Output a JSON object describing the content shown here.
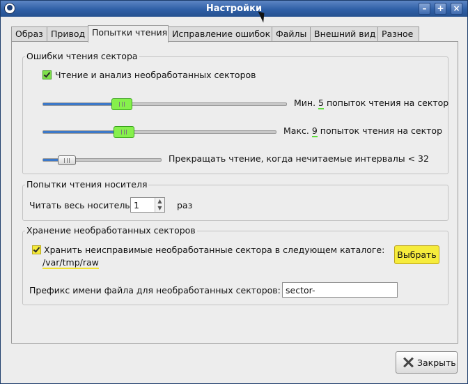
{
  "window": {
    "title": "Настройки"
  },
  "tabs": [
    {
      "label": "Образ",
      "active": false
    },
    {
      "label": "Привод",
      "active": false
    },
    {
      "label": "Попытки чтения",
      "active": true
    },
    {
      "label": "Исправление ошибок",
      "active": false
    },
    {
      "label": "Файлы",
      "active": false
    },
    {
      "label": "Внешний вид",
      "active": false
    },
    {
      "label": "Разное",
      "active": false
    }
  ],
  "sector_errors": {
    "legend": "Ошибки чтения сектора",
    "raw_checkbox_label": "Чтение и анализ необработанных секторов",
    "raw_checked": true,
    "min_retries": {
      "prefix": "Мин.",
      "value": "5",
      "suffix": "попыток чтения на сектор",
      "fraction": 0.32
    },
    "max_retries": {
      "prefix": "Макс.",
      "value": "9",
      "suffix": "попыток чтения на сектор",
      "fraction": 0.33
    },
    "skip_label": "Прекращать чтение, когда нечитаемые интервалы < 32",
    "skip_fraction": 0.2
  },
  "media_retries": {
    "legend": "Попытки чтения носителя",
    "read_label": "Читать весь носитель",
    "count": "1",
    "unit": "раз"
  },
  "raw_storage": {
    "legend": "Хранение необработанных секторов",
    "store_checkbox_label": "Хранить неисправимые необработанные сектора в следующем каталоге:",
    "store_checked": true,
    "path": "/var/tmp/raw",
    "choose_button": "Выбрать",
    "prefix_label": "Префикс имени файла для необработанных секторов:",
    "prefix_value": "sector-"
  },
  "footer": {
    "close_button": "Закрыть"
  },
  "colors": {
    "title_bar": "#2f5fa6",
    "highlight_green": "#86f04c",
    "highlight_yellow": "#f6ec3c",
    "slider_fill": "#3c78c8"
  }
}
